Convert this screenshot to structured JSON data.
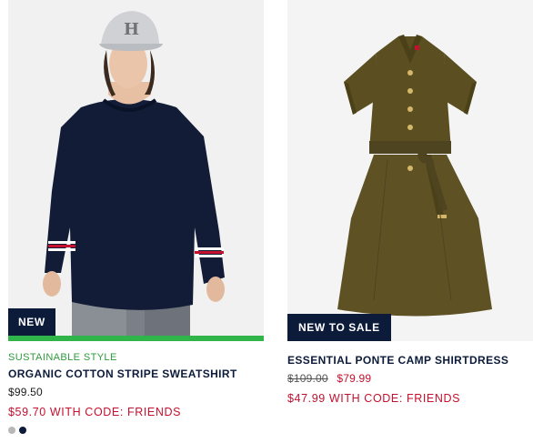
{
  "products": [
    {
      "badge": "NEW",
      "tag": "SUSTAINABLE STYLE",
      "name": "ORGANIC COTTON STRIPE SWEATSHIRT",
      "price": "$99.50",
      "promo": "$59.70 WITH CODE: FRIENDS",
      "image_alt": "Model wearing navy sweatshirt with cap",
      "swatches": [
        {
          "name": "grey",
          "color": "#b8b8b8"
        },
        {
          "name": "navy",
          "color": "#0c1b3a"
        }
      ]
    },
    {
      "badge": "NEW TO SALE",
      "name": "ESSENTIAL PONTE CAMP SHIRTDRESS",
      "price_original": "$109.00",
      "price_sale": "$79.99",
      "promo": "$47.99 WITH CODE: FRIENDS",
      "image_alt": "Olive belted shirt dress"
    }
  ],
  "colors": {
    "navy": "#0c1b3a",
    "sale_red": "#c5102e",
    "sustain_green": "#2f9a3c",
    "green_bar": "#2fb54a",
    "olive": "#5b4f22"
  }
}
